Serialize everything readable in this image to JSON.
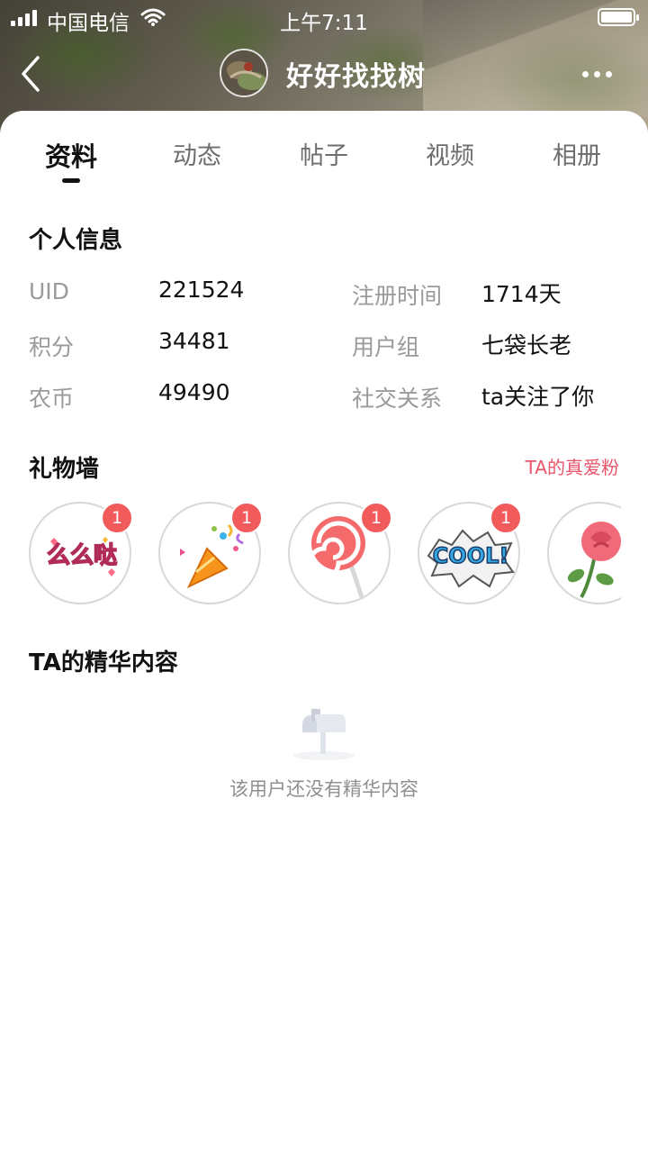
{
  "status_bar": {
    "carrier": "中国电信",
    "time": "上午7:11"
  },
  "nav": {
    "title": "好好找找树",
    "icons": [
      "back-icon",
      "avatar",
      "more-icon"
    ]
  },
  "tabs": [
    {
      "label": "资料",
      "active": true
    },
    {
      "label": "动态",
      "active": false
    },
    {
      "label": "帖子",
      "active": false
    },
    {
      "label": "视频",
      "active": false
    },
    {
      "label": "相册",
      "active": false
    }
  ],
  "personal_info": {
    "title": "个人信息",
    "rows": [
      {
        "label": "UID",
        "value": "221524"
      },
      {
        "label": "积分",
        "value": "34481"
      },
      {
        "label": "农币",
        "value": "49490"
      },
      {
        "label": "注册时间",
        "value": "1714天"
      },
      {
        "label": "用户组",
        "value": "七袋长老"
      },
      {
        "label": "社交关系",
        "value": "ta关注了你"
      }
    ]
  },
  "gift_wall": {
    "title": "礼物墙",
    "fans_link": "TA的真爱粉",
    "gifts": [
      {
        "name": "么么哒",
        "count": "1",
        "icon": "kiss-text-sticker"
      },
      {
        "name": "party popper",
        "count": "1",
        "icon": "party-popper-icon"
      },
      {
        "name": "lollipop",
        "count": "1",
        "icon": "lollipop-icon"
      },
      {
        "name": "COOL!",
        "count": "1",
        "icon": "cool-sticker"
      },
      {
        "name": "rose",
        "count": "",
        "icon": "rose-icon"
      }
    ],
    "kiss_text": "么么哒",
    "cool_text": "COOL!"
  },
  "featured": {
    "title": "TA的精华内容",
    "empty_text": "该用户还没有精华内容",
    "icon": "mailbox-icon"
  },
  "colors": {
    "accent_red": "#e8546a",
    "badge_red": "#f25b5b"
  }
}
